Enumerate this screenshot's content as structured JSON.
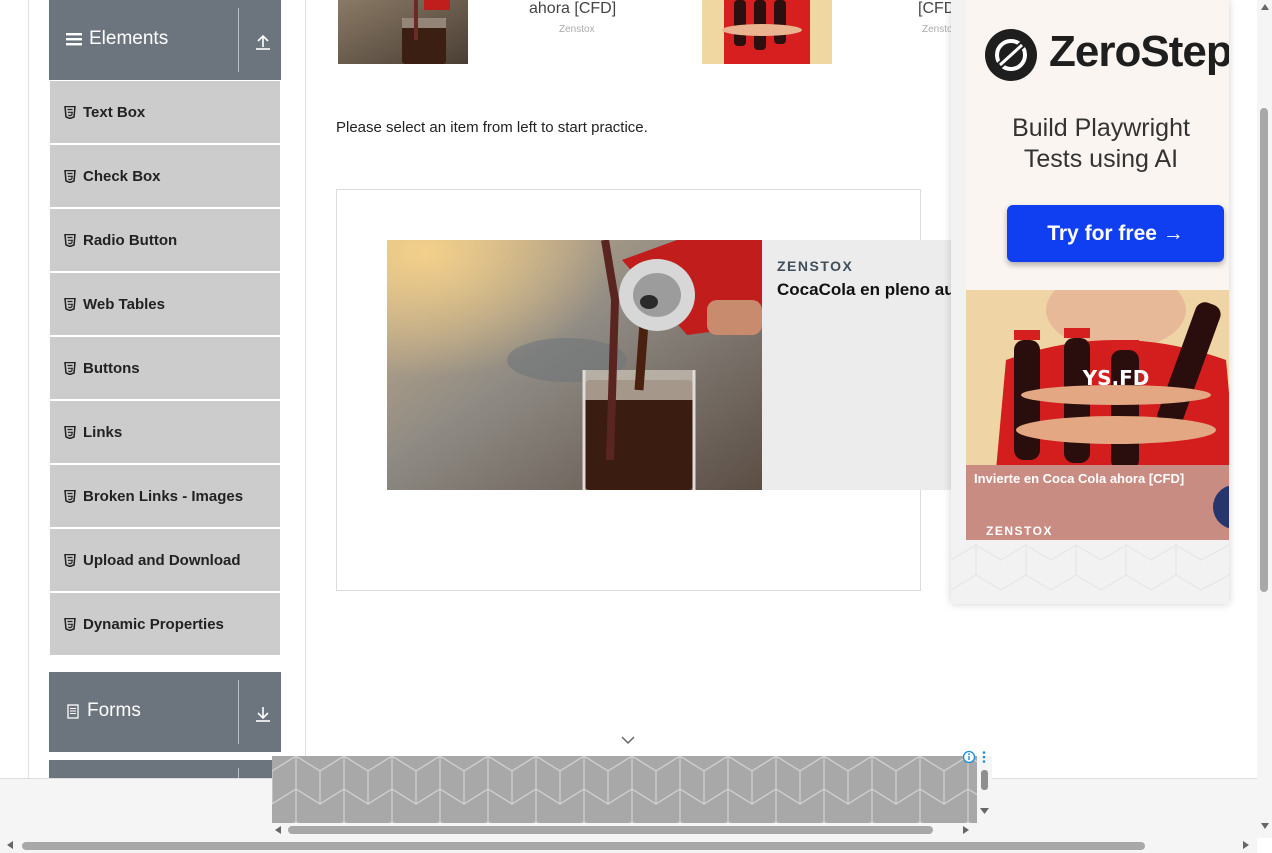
{
  "sidebar": {
    "elements_header": "Elements",
    "items": [
      {
        "label": "Text Box"
      },
      {
        "label": "Check Box"
      },
      {
        "label": "Radio Button"
      },
      {
        "label": "Web Tables"
      },
      {
        "label": "Buttons"
      },
      {
        "label": "Links"
      },
      {
        "label": "Broken Links - Images"
      },
      {
        "label": "Upload and Download"
      },
      {
        "label": "Dynamic Properties"
      }
    ],
    "forms_header": "Forms"
  },
  "top_strip": {
    "item1_title": "ahora [CFD]",
    "item1_source": "Zenstox",
    "item2_title": "[CFD]",
    "item2_source": "Zenstox"
  },
  "main": {
    "practice_text": "Please select an item from left to start practice."
  },
  "content_ad": {
    "brand": "ZENSTOX",
    "headline": "CocaCola en pleno auge"
  },
  "side_ad": {
    "logo_text": "ZeroStep",
    "subtitle_line1": "Build Playwright",
    "subtitle_line2": "Tests using AI",
    "cta": "Try for free →",
    "caption": "Invierte en Coca Cola ahora [CFD]",
    "caption_brand": "ZENSTOX"
  },
  "colors": {
    "sidebar_header": "#6c757d",
    "sidebar_item": "#cccccc",
    "cta_blue": "#0f3ff0",
    "next_button": "#27356d"
  }
}
